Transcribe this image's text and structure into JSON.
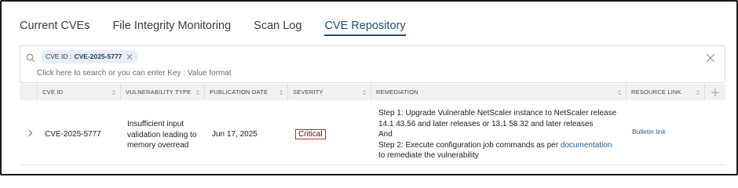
{
  "tabs": [
    {
      "label": "Current CVEs"
    },
    {
      "label": "File Integrity Monitoring"
    },
    {
      "label": "Scan Log"
    },
    {
      "label": "CVE Repository"
    }
  ],
  "search": {
    "chip_key": "CVE ID :",
    "chip_value": "CVE-2025-5777",
    "hint": "Click here to search or you can enter Key : Value format"
  },
  "table": {
    "columns": [
      "CVE ID",
      "VULNERABILITY TYPE",
      "PUBLICATION DATE",
      "SEVERITY",
      "REMEDIATION",
      "RESOURCE LINK"
    ],
    "row": {
      "cve_id": "CVE-2025-5777",
      "vuln_type": [
        "Insufficient input",
        "validation leading to",
        "memory overread"
      ],
      "publication_date": "Jun 17, 2025",
      "severity": "Critical",
      "remediation": {
        "line1": "Step 1: Upgrade Vulnerable NetScaler instance to NetScaler release",
        "line2": "14.1 43.56 and later releases or 13.1 58.32 and later releases",
        "line3": "And",
        "line4_prefix": "Step 2: Execute configuration job commands as per",
        "line4_link": "documentation",
        "line5": "to remediate the vulnerability"
      },
      "resource_link": "Bulletin link"
    }
  },
  "colors": {
    "active_tab": "#1f4f72",
    "link": "#1f5f8b",
    "severity_critical": "#c62828",
    "header_bg": "#f1f1f1"
  },
  "icons": [
    "search-icon",
    "close-icon",
    "sort-icon",
    "plus-icon",
    "chevron-right-icon"
  ]
}
